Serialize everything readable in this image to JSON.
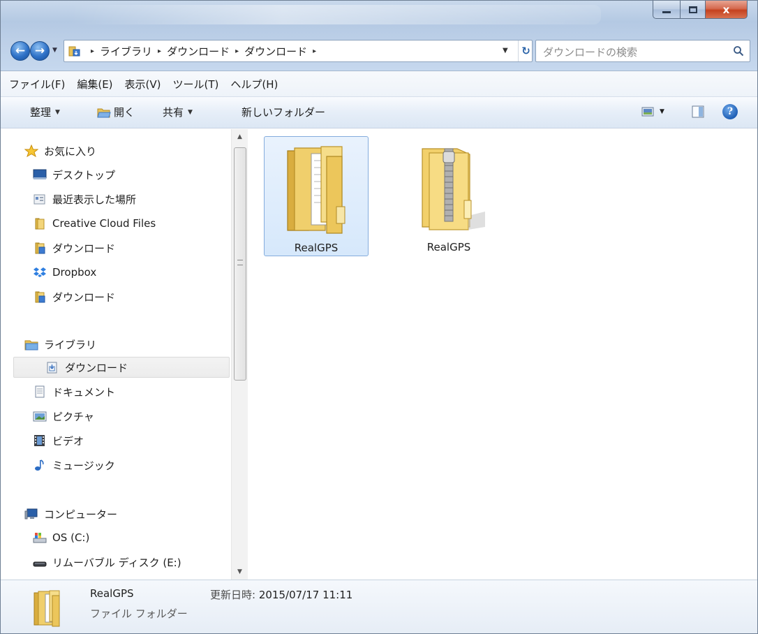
{
  "window": {
    "close_glyph": "x"
  },
  "nav": {
    "back_glyph": "←",
    "forward_glyph": "→",
    "recent_glyph": "▼"
  },
  "address": {
    "crumbs": [
      "ライブラリ",
      "ダウンロード",
      "ダウンロード"
    ],
    "separator": "▸",
    "dropdown_glyph": "▼",
    "refresh_glyph": "↻"
  },
  "search": {
    "placeholder": "ダウンロードの検索"
  },
  "menubar": {
    "items": [
      "ファイル(F)",
      "編集(E)",
      "表示(V)",
      "ツール(T)",
      "ヘルプ(H)"
    ]
  },
  "toolbar": {
    "organize": "整理",
    "open": "開く",
    "share": "共有",
    "new_folder": "新しいフォルダー",
    "dropdown_glyph": "▼",
    "help_glyph": "?"
  },
  "navpane": {
    "favorites": {
      "label": "お気に入り",
      "items": [
        "デスクトップ",
        "最近表示した場所",
        "Creative Cloud Files",
        "ダウンロード",
        "Dropbox",
        "ダウンロード"
      ]
    },
    "libraries": {
      "label": "ライブラリ",
      "items": [
        "ダウンロード",
        "ドキュメント",
        "ピクチャ",
        "ビデオ",
        "ミュージック"
      ],
      "selected": "ダウンロード"
    },
    "computer": {
      "label": "コンピューター",
      "items": [
        "OS (C:)",
        "リムーバブル ディスク (E:)"
      ]
    },
    "scroll_up": "▲",
    "scroll_down": "▼"
  },
  "files": [
    {
      "name": "RealGPS",
      "type": "folder",
      "selected": true
    },
    {
      "name": "RealGPS",
      "type": "zip",
      "selected": false
    }
  ],
  "details": {
    "name": "RealGPS",
    "type": "ファイル フォルダー",
    "modified_label": "更新日時:",
    "modified_value": "2015/07/17 11:11"
  },
  "colors": {
    "accent": "#2f72c8",
    "selection": "#d6e8fb",
    "folder": "#f2d06b"
  }
}
